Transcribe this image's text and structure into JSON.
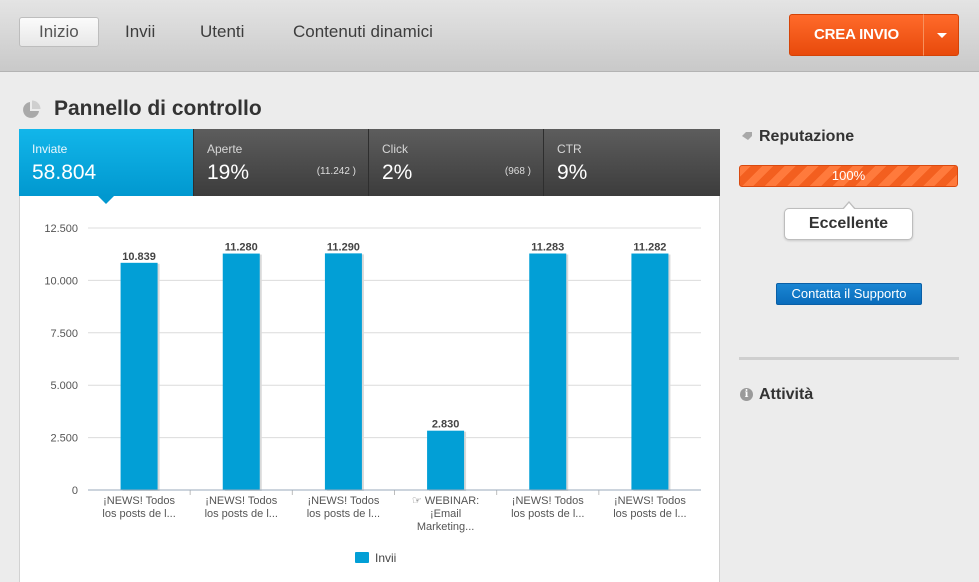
{
  "nav": {
    "tabs": [
      {
        "label": "Inizio",
        "active": true
      },
      {
        "label": "Invii"
      },
      {
        "label": "Utenti"
      },
      {
        "label": "Contenuti dinamici"
      }
    ],
    "create_label": "CREA INVIO",
    "create_menu_icon": "caret-down-icon"
  },
  "page": {
    "title": "Pannello di controllo",
    "title_icon": "pie-chart-icon"
  },
  "stats": [
    {
      "label": "Inviate",
      "value": "58.804",
      "sub": "",
      "active": true
    },
    {
      "label": "Aperte",
      "value": "19%",
      "sub": "(11.242 )"
    },
    {
      "label": "Click",
      "value": "2%",
      "sub": "(968 )"
    },
    {
      "label": "CTR",
      "value": "9%",
      "sub": ""
    }
  ],
  "chart_data": {
    "type": "bar",
    "categories": [
      [
        "¡NEWS! Todos",
        "los posts de l..."
      ],
      [
        "¡NEWS! Todos",
        "los posts de l..."
      ],
      [
        "¡NEWS! Todos",
        "los posts de l..."
      ],
      [
        "☞ WEBINAR:",
        "¡Email",
        "Marketing..."
      ],
      [
        "¡NEWS! Todos",
        "los posts de l..."
      ],
      [
        "¡NEWS! Todos",
        "los posts de l..."
      ]
    ],
    "series": [
      {
        "name": "Invii",
        "values": [
          10839,
          11280,
          11290,
          2830,
          11283,
          11282
        ],
        "value_labels": [
          "10.839",
          "11.280",
          "11.290",
          "2.830",
          "11.283",
          "11.282"
        ]
      }
    ],
    "ylim": [
      0,
      12500
    ],
    "yticks": [
      0,
      2500,
      5000,
      7500,
      10000,
      12500
    ],
    "ytick_labels": [
      "0",
      "2.500",
      "5.000",
      "7.500",
      "10.000",
      "12.500"
    ],
    "grid": true,
    "legend": "bottom",
    "color": "#029fd6"
  },
  "sidebar": {
    "reputation_title": "Reputazione",
    "reputation_icon": "tag-icon",
    "reputation_value": "100%",
    "reputation_level": 1.0,
    "reputation_label": "Eccellente",
    "support_label": "Contatta il Supporto",
    "activity_title": "Attività",
    "activity_icon": "info-icon"
  }
}
